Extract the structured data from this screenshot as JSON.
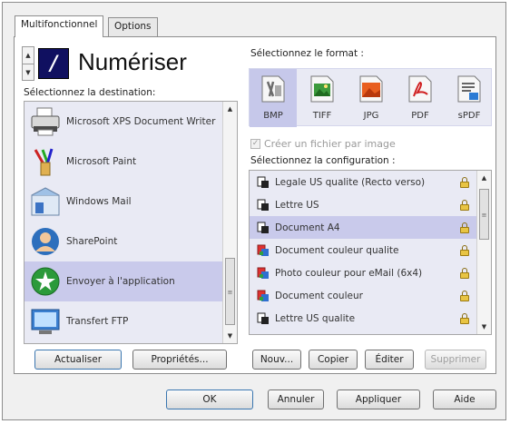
{
  "tabs": [
    {
      "label": "Multifonctionnel",
      "active": true
    },
    {
      "label": "Options",
      "active": false
    }
  ],
  "header": {
    "sequence_glyph": "/",
    "title": "Numériser"
  },
  "destinations": {
    "label": "Sélectionnez la destination:",
    "items": [
      {
        "label": "Microsoft XPS Document Writer",
        "icon": "printer-icon",
        "selected": false
      },
      {
        "label": "Microsoft Paint",
        "icon": "paint-brush-icon",
        "selected": false
      },
      {
        "label": "Windows Mail",
        "icon": "windows-mail-icon",
        "selected": false
      },
      {
        "label": "SharePoint",
        "icon": "sharepoint-icon",
        "selected": false
      },
      {
        "label": "Envoyer à l'application",
        "icon": "send-to-application-icon",
        "selected": true
      },
      {
        "label": "Transfert FTP",
        "icon": "ftp-transfer-icon",
        "selected": false
      }
    ],
    "buttons": {
      "refresh": "Actualiser",
      "properties": "Propriétés..."
    }
  },
  "format": {
    "label": "Sélectionnez le format :",
    "items": [
      {
        "label": "BMP",
        "icon": "bmp-file-icon",
        "selected": true
      },
      {
        "label": "TIFF",
        "icon": "tiff-file-icon",
        "selected": false
      },
      {
        "label": "JPG",
        "icon": "jpg-file-icon",
        "selected": false
      },
      {
        "label": "PDF",
        "icon": "pdf-file-icon",
        "selected": false
      },
      {
        "label": "sPDF",
        "icon": "spdf-file-icon",
        "selected": false
      }
    ],
    "checkbox": {
      "label": "Créer un fichier par image",
      "checked": true,
      "disabled": true,
      "mark": "✓"
    }
  },
  "configuration": {
    "label": "Sélectionnez la configuration :",
    "items": [
      {
        "label": "Legale US qualite (Recto verso)",
        "icon": "bw-document-icon",
        "selected": false
      },
      {
        "label": "Lettre US",
        "icon": "bw-document-icon",
        "selected": false
      },
      {
        "label": "Document A4",
        "icon": "bw-document-icon",
        "selected": true
      },
      {
        "label": "Document couleur qualite",
        "icon": "color-document-icon",
        "selected": false
      },
      {
        "label": "Photo couleur pour eMail (6x4)",
        "icon": "color-document-icon",
        "selected": false
      },
      {
        "label": "Document couleur",
        "icon": "color-document-icon",
        "selected": false
      },
      {
        "label": "Lettre US qualite",
        "icon": "bw-document-icon",
        "selected": false
      }
    ],
    "buttons": {
      "new": "Nouv...",
      "copy": "Copier",
      "edit": "Éditer",
      "delete": "Supprimer"
    }
  },
  "dialog_buttons": {
    "ok": "OK",
    "cancel": "Annuler",
    "apply": "Appliquer",
    "help": "Aide"
  },
  "colors": {
    "list_background": "#e9eaf4",
    "selection": "#c9caeb",
    "sequence_box": "#101060"
  }
}
